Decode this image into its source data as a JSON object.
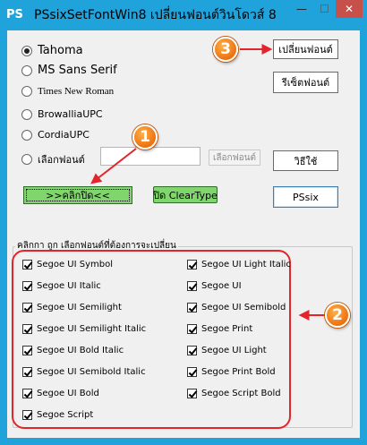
{
  "window": {
    "app_icon": "PS",
    "title": "PSsixSetFontWin8 เปลี่ยนฟอนต์วินโดวส์ 8",
    "minimize": "—",
    "maximize": "☐",
    "close": "✕"
  },
  "fonts": [
    {
      "label": "Tahoma",
      "checked": true
    },
    {
      "label": "MS Sans Serif",
      "checked": false
    },
    {
      "label": "Times New Roman",
      "checked": false
    },
    {
      "label": "BrowalliaUPC",
      "checked": false
    },
    {
      "label": "CordiaUPC",
      "checked": false
    },
    {
      "label": "เลือกฟอนต์",
      "checked": false
    }
  ],
  "custom_font": {
    "value": "",
    "button_label": "เลือกฟอนต์"
  },
  "buttons": {
    "change_font": "เปลี่ยนฟอนต์",
    "reset_font": "รีเซ็ตฟอนต์",
    "help": "วิธีใช้",
    "click_off": ">>คลิกปิด<<",
    "cleartype_off": "ปิด ClearType",
    "pssix": "PSsix"
  },
  "group": {
    "title": "คลิกกา ถูก เลือกฟอนต์ที่ต้องการจะเปลี่ยน",
    "left": [
      "Segoe UI Symbol",
      "Segoe UI Italic",
      "Segoe UI Semilight",
      "Segoe UI Semilight Italic",
      "Segoe UI Bold Italic",
      "Segoe UI Semibold Italic",
      "Segoe UI Bold",
      "Segoe Script"
    ],
    "right": [
      "Segoe UI Light Italic",
      "Segoe UI",
      "Segoe UI Semibold",
      "Segoe Print",
      "Segoe UI Light",
      "Segoe Print Bold",
      "Segoe Script Bold"
    ]
  },
  "badges": {
    "one": "1",
    "two": "2",
    "three": "3"
  },
  "colors": {
    "title_bar": "#20a3da",
    "close": "#c7504b",
    "green_button": "#7fd66b",
    "callout_red": "#e3242b",
    "badge_orange": "#ec7110"
  }
}
